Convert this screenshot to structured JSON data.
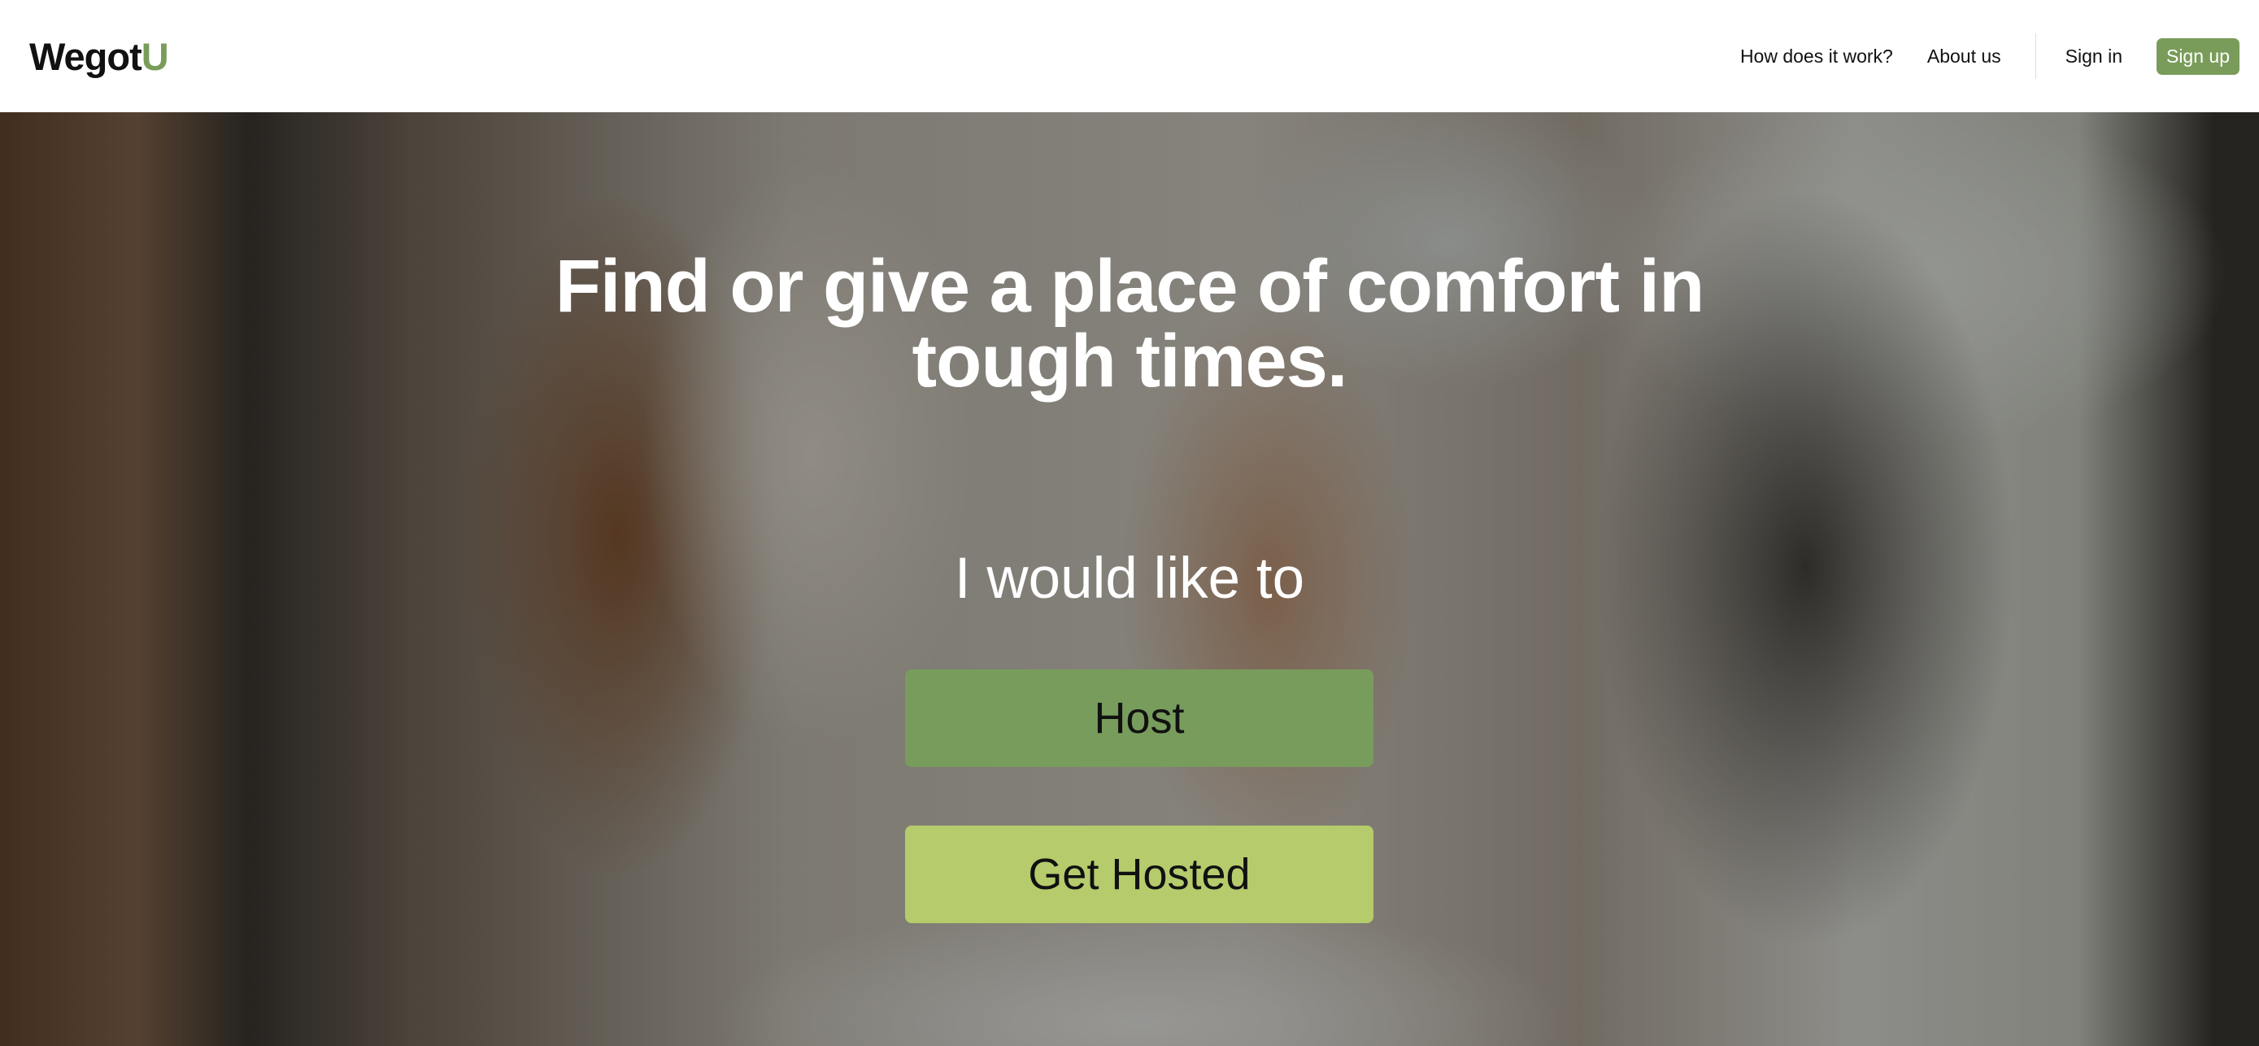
{
  "header": {
    "logo_main": "Wegot",
    "logo_accent": "U",
    "nav": {
      "how_it_works": "How does it work?",
      "about_us": "About us",
      "sign_in": "Sign in",
      "sign_up": "Sign up"
    }
  },
  "hero": {
    "title": "Find or give a place of comfort in tough times.",
    "subtitle": "I would like to",
    "host_button": "Host",
    "get_hosted_button": "Get Hosted"
  },
  "colors": {
    "brand_green": "#7a9c5a",
    "host_button": "#789c5c",
    "get_hosted_button": "#b5cb6c"
  }
}
